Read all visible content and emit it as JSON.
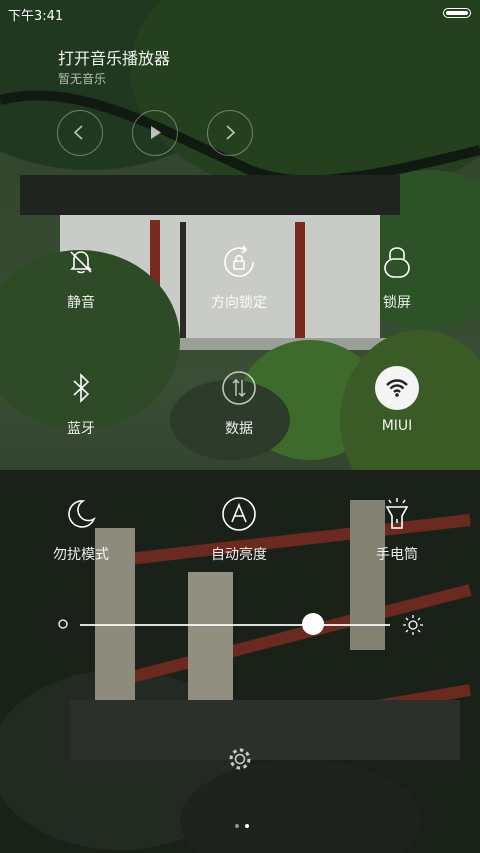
{
  "status_bar": {
    "time": "下午3:41",
    "battery_level": 1.0
  },
  "music": {
    "title": "打开音乐播放器",
    "subtitle": "暂无音乐",
    "controls": [
      {
        "name": "previous",
        "icon": "chevron-left-icon"
      },
      {
        "name": "play",
        "icon": "play-icon"
      },
      {
        "name": "next",
        "icon": "chevron-right-icon"
      }
    ]
  },
  "toggles": [
    {
      "label": "静音",
      "icon": "bell-off-icon",
      "active": false
    },
    {
      "label": "方向锁定",
      "icon": "rotation-lock-icon",
      "active": false
    },
    {
      "label": "锁屏",
      "icon": "lock-icon",
      "active": false
    },
    {
      "label": "蓝牙",
      "icon": "bluetooth-icon",
      "active": false
    },
    {
      "label": "数据",
      "icon": "mobile-data-icon",
      "active": false
    },
    {
      "label": "MIUI",
      "icon": "wifi-icon",
      "active": true
    },
    {
      "label": "勿扰模式",
      "icon": "moon-icon",
      "active": false
    },
    {
      "label": "自动亮度",
      "icon": "auto-brightness-icon",
      "active": false
    },
    {
      "label": "手电筒",
      "icon": "flashlight-icon",
      "active": false
    }
  ],
  "brightness": {
    "level": 0.75,
    "low_icon": "brightness-low-icon",
    "high_icon": "brightness-high-icon"
  },
  "settings_icon": "gear-icon",
  "pager": {
    "pages": 2,
    "current": 2
  }
}
